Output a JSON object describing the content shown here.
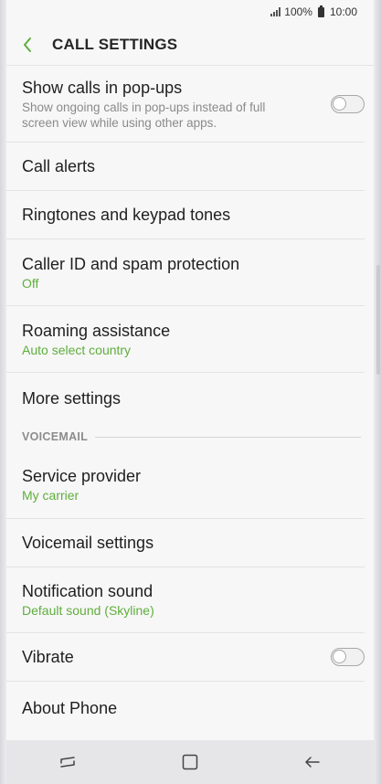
{
  "status_bar": {
    "battery": "100%",
    "time": "10:00"
  },
  "header": {
    "title": "CALL SETTINGS"
  },
  "items": {
    "popups": {
      "label": "Show calls in pop-ups",
      "description": "Show ongoing calls in pop-ups instead of full screen view while using other apps.",
      "toggle_on": false
    },
    "call_alerts": {
      "label": "Call alerts"
    },
    "ringtones": {
      "label": "Ringtones and keypad tones"
    },
    "caller_id": {
      "label": "Caller ID and spam protection",
      "value": "Off"
    },
    "roaming": {
      "label": "Roaming assistance",
      "value": "Auto select country"
    },
    "more": {
      "label": "More settings"
    },
    "voicemail_section": {
      "label": "VOICEMAIL"
    },
    "provider": {
      "label": "Service provider",
      "value": "My carrier"
    },
    "voicemail_settings": {
      "label": "Voicemail settings"
    },
    "notification": {
      "label": "Notification sound",
      "value": "Default sound (Skyline)"
    },
    "vibrate": {
      "label": "Vibrate",
      "toggle_on": false
    },
    "about": {
      "label": "About Phone"
    }
  },
  "colors": {
    "accent": "#5fae3c",
    "text": "#1f1f1f",
    "secondary": "#8a8a8a"
  },
  "nav": {
    "icons": [
      "recent-apps-icon",
      "home-icon",
      "back-icon"
    ]
  }
}
